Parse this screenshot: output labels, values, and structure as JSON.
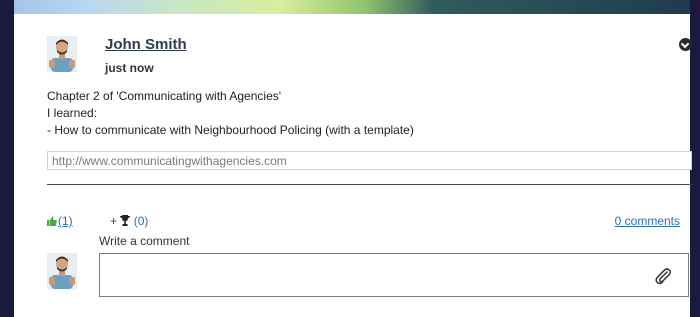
{
  "post": {
    "author": "John Smith",
    "time": "just now",
    "lines": [
      "Chapter 2 of 'Communicating with Agencies'",
      "I learned:",
      "- How to communicate with Neighbourhood Policing (with a template)"
    ],
    "link": "http://www.communicatingwithagencies.com"
  },
  "actions": {
    "like_count": "(1)",
    "award_plus": "+",
    "award_count": "(0)",
    "comments": "0 comments"
  },
  "comment_form": {
    "label": "Write a comment"
  },
  "icons": {
    "menu": "chevron-down-circle-icon",
    "like": "thumbs-up-icon",
    "award": "trophy-icon",
    "attach": "paperclip-icon"
  },
  "colors": {
    "link": "#2a6fb5",
    "like_icon": "#4aa84a",
    "frame": "#1b1940"
  }
}
